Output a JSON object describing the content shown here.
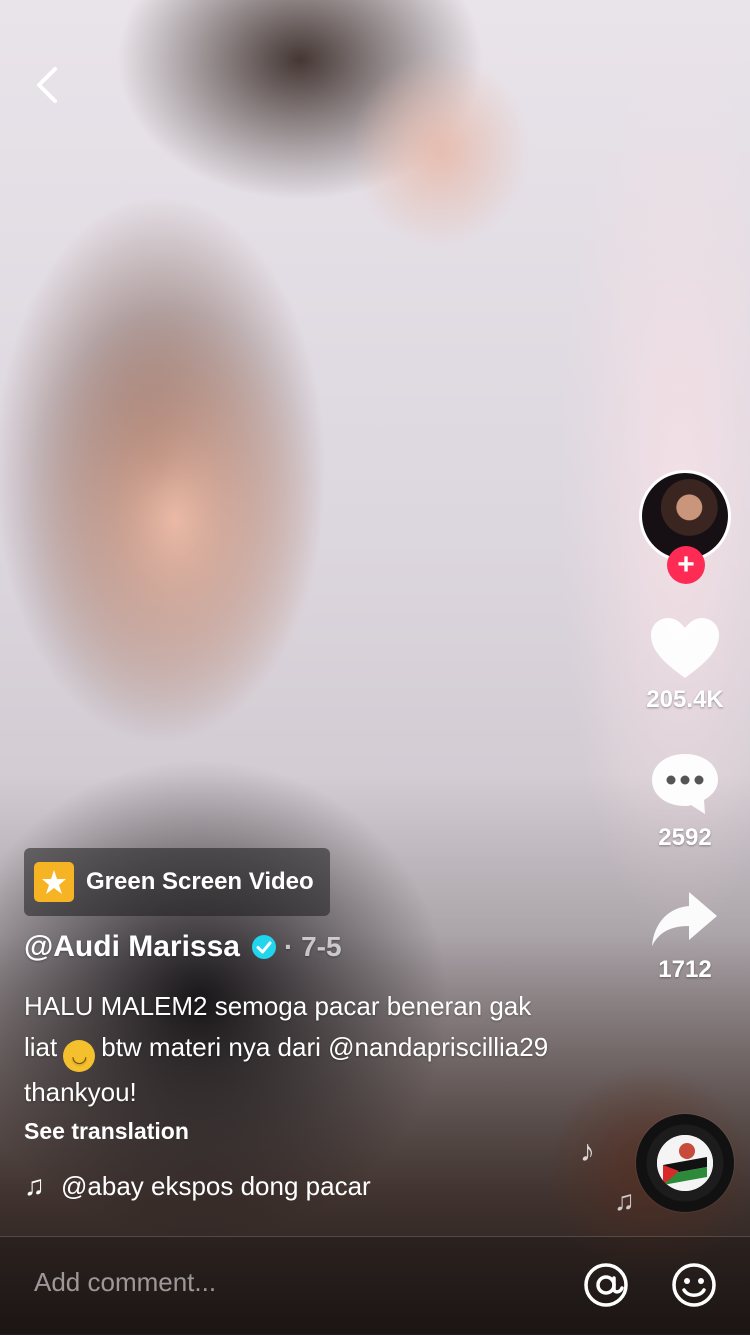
{
  "actions": {
    "likes": "205.4K",
    "comments": "2592",
    "shares": "1712",
    "follow_symbol": "+"
  },
  "effect": {
    "label": "Green Screen Video"
  },
  "post": {
    "username": "@Audi Marissa",
    "date": "· 7-5",
    "caption_part1": "HALU MALEM2 semoga pacar beneran gak liat",
    "caption_part2": "btw materi nya dari @nandapriscillia29 thankyou!",
    "see_translation": "See translation"
  },
  "sound": {
    "text": "@abay    ekspos dong pacar"
  },
  "comment_bar": {
    "placeholder": "Add comment..."
  },
  "colors": {
    "accent": "#fe2c55",
    "verified": "#20d5ec",
    "effect_badge": "#f6b425"
  },
  "icons": [
    "back-icon",
    "heart-icon",
    "comment-icon",
    "share-icon",
    "music-note-icon",
    "at-icon",
    "emoji-icon",
    "verified-icon"
  ]
}
